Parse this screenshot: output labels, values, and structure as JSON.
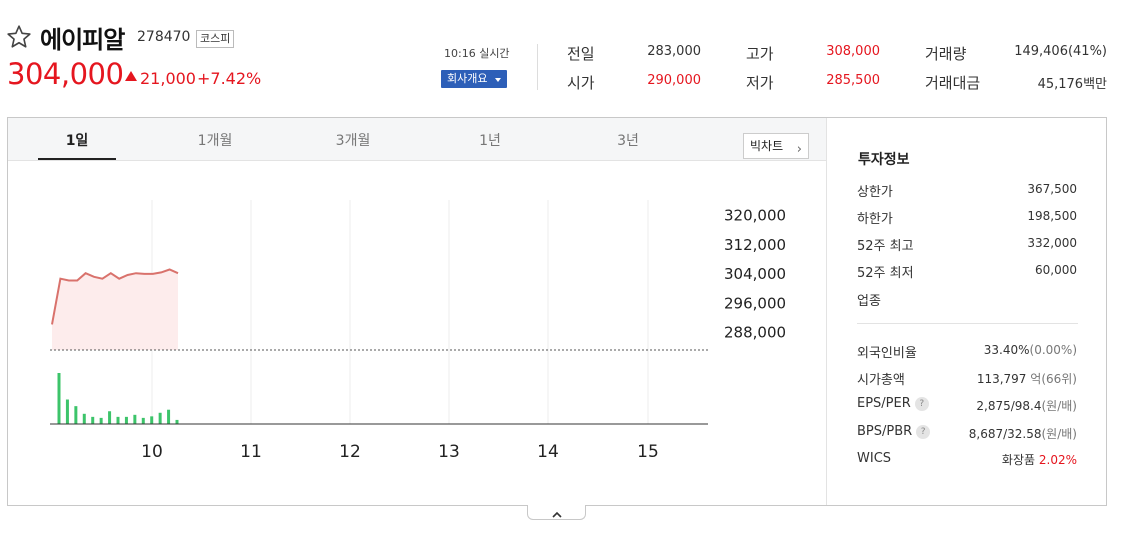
{
  "stock": {
    "name": "에이피알",
    "code": "278470",
    "market": "코스피",
    "price": "304,000",
    "change": "21,000",
    "change_pct": "+7.42%",
    "realtime": "10:16 실시간",
    "company_button": "회사개요"
  },
  "quotes": [
    {
      "label": "전일",
      "value": "283,000",
      "color": "#333333"
    },
    {
      "label": "시가",
      "value": "290,000",
      "color": "#e5161f"
    },
    {
      "label": "고가",
      "value": "308,000",
      "color": "#e5161f"
    },
    {
      "label": "저가",
      "value": "285,500",
      "color": "#e5161f"
    },
    {
      "label": "거래량",
      "value": "149,406(41%)",
      "color": "#333333"
    },
    {
      "label": "거래대금",
      "value": "45,176백만",
      "color": "#333333"
    }
  ],
  "tabs": [
    "1일",
    "1개월",
    "3개월",
    "1년",
    "3년"
  ],
  "bigchart_label": "빅차트",
  "investment": {
    "title": "투자정보",
    "upper_limit_label": "상한가",
    "upper_limit": "367,500",
    "lower_limit_label": "하한가",
    "lower_limit": "198,500",
    "high52_label": "52주 최고",
    "high52": "332,000",
    "low52_label": "52주 최저",
    "low52": "60,000",
    "sector_label": "업종",
    "foreign_label": "외국인비율",
    "foreign": "33.40%",
    "foreign_sub": "(0.00%)",
    "mcap_label": "시가총액",
    "mcap": "113,797",
    "mcap_unit": "억",
    "mcap_sub": "(66위)",
    "eps_label": "EPS/PER",
    "eps": "2,875/98.4",
    "eps_unit": "(원/배)",
    "bps_label": "BPS/PBR",
    "bps": "8,687/32.58",
    "bps_unit": "(원/배)",
    "wics_label": "WICS",
    "wics_sector": "화장품",
    "wics_pct": "2.02%"
  },
  "colors": {
    "up": "#e5161f",
    "down": "#1a5fc9",
    "line": "#d9726c",
    "area": "#fdecec",
    "volume": "#3cc46a"
  },
  "chart_data": {
    "type": "line",
    "x_ticks": [
      "10",
      "11",
      "12",
      "13",
      "14",
      "15"
    ],
    "y_ticks": [
      "320,000",
      "312,000",
      "304,000",
      "296,000",
      "288,000"
    ],
    "ylim": [
      283000,
      324000
    ],
    "prev_close": 283000,
    "price_series": [
      290000,
      302500,
      302000,
      302000,
      304000,
      303000,
      302500,
      304000,
      302500,
      303500,
      304000,
      303800,
      303800,
      304200,
      305000,
      304000
    ],
    "volume_series": [
      100,
      48,
      35,
      20,
      14,
      12,
      25,
      14,
      14,
      18,
      12,
      15,
      22,
      28,
      8
    ]
  }
}
